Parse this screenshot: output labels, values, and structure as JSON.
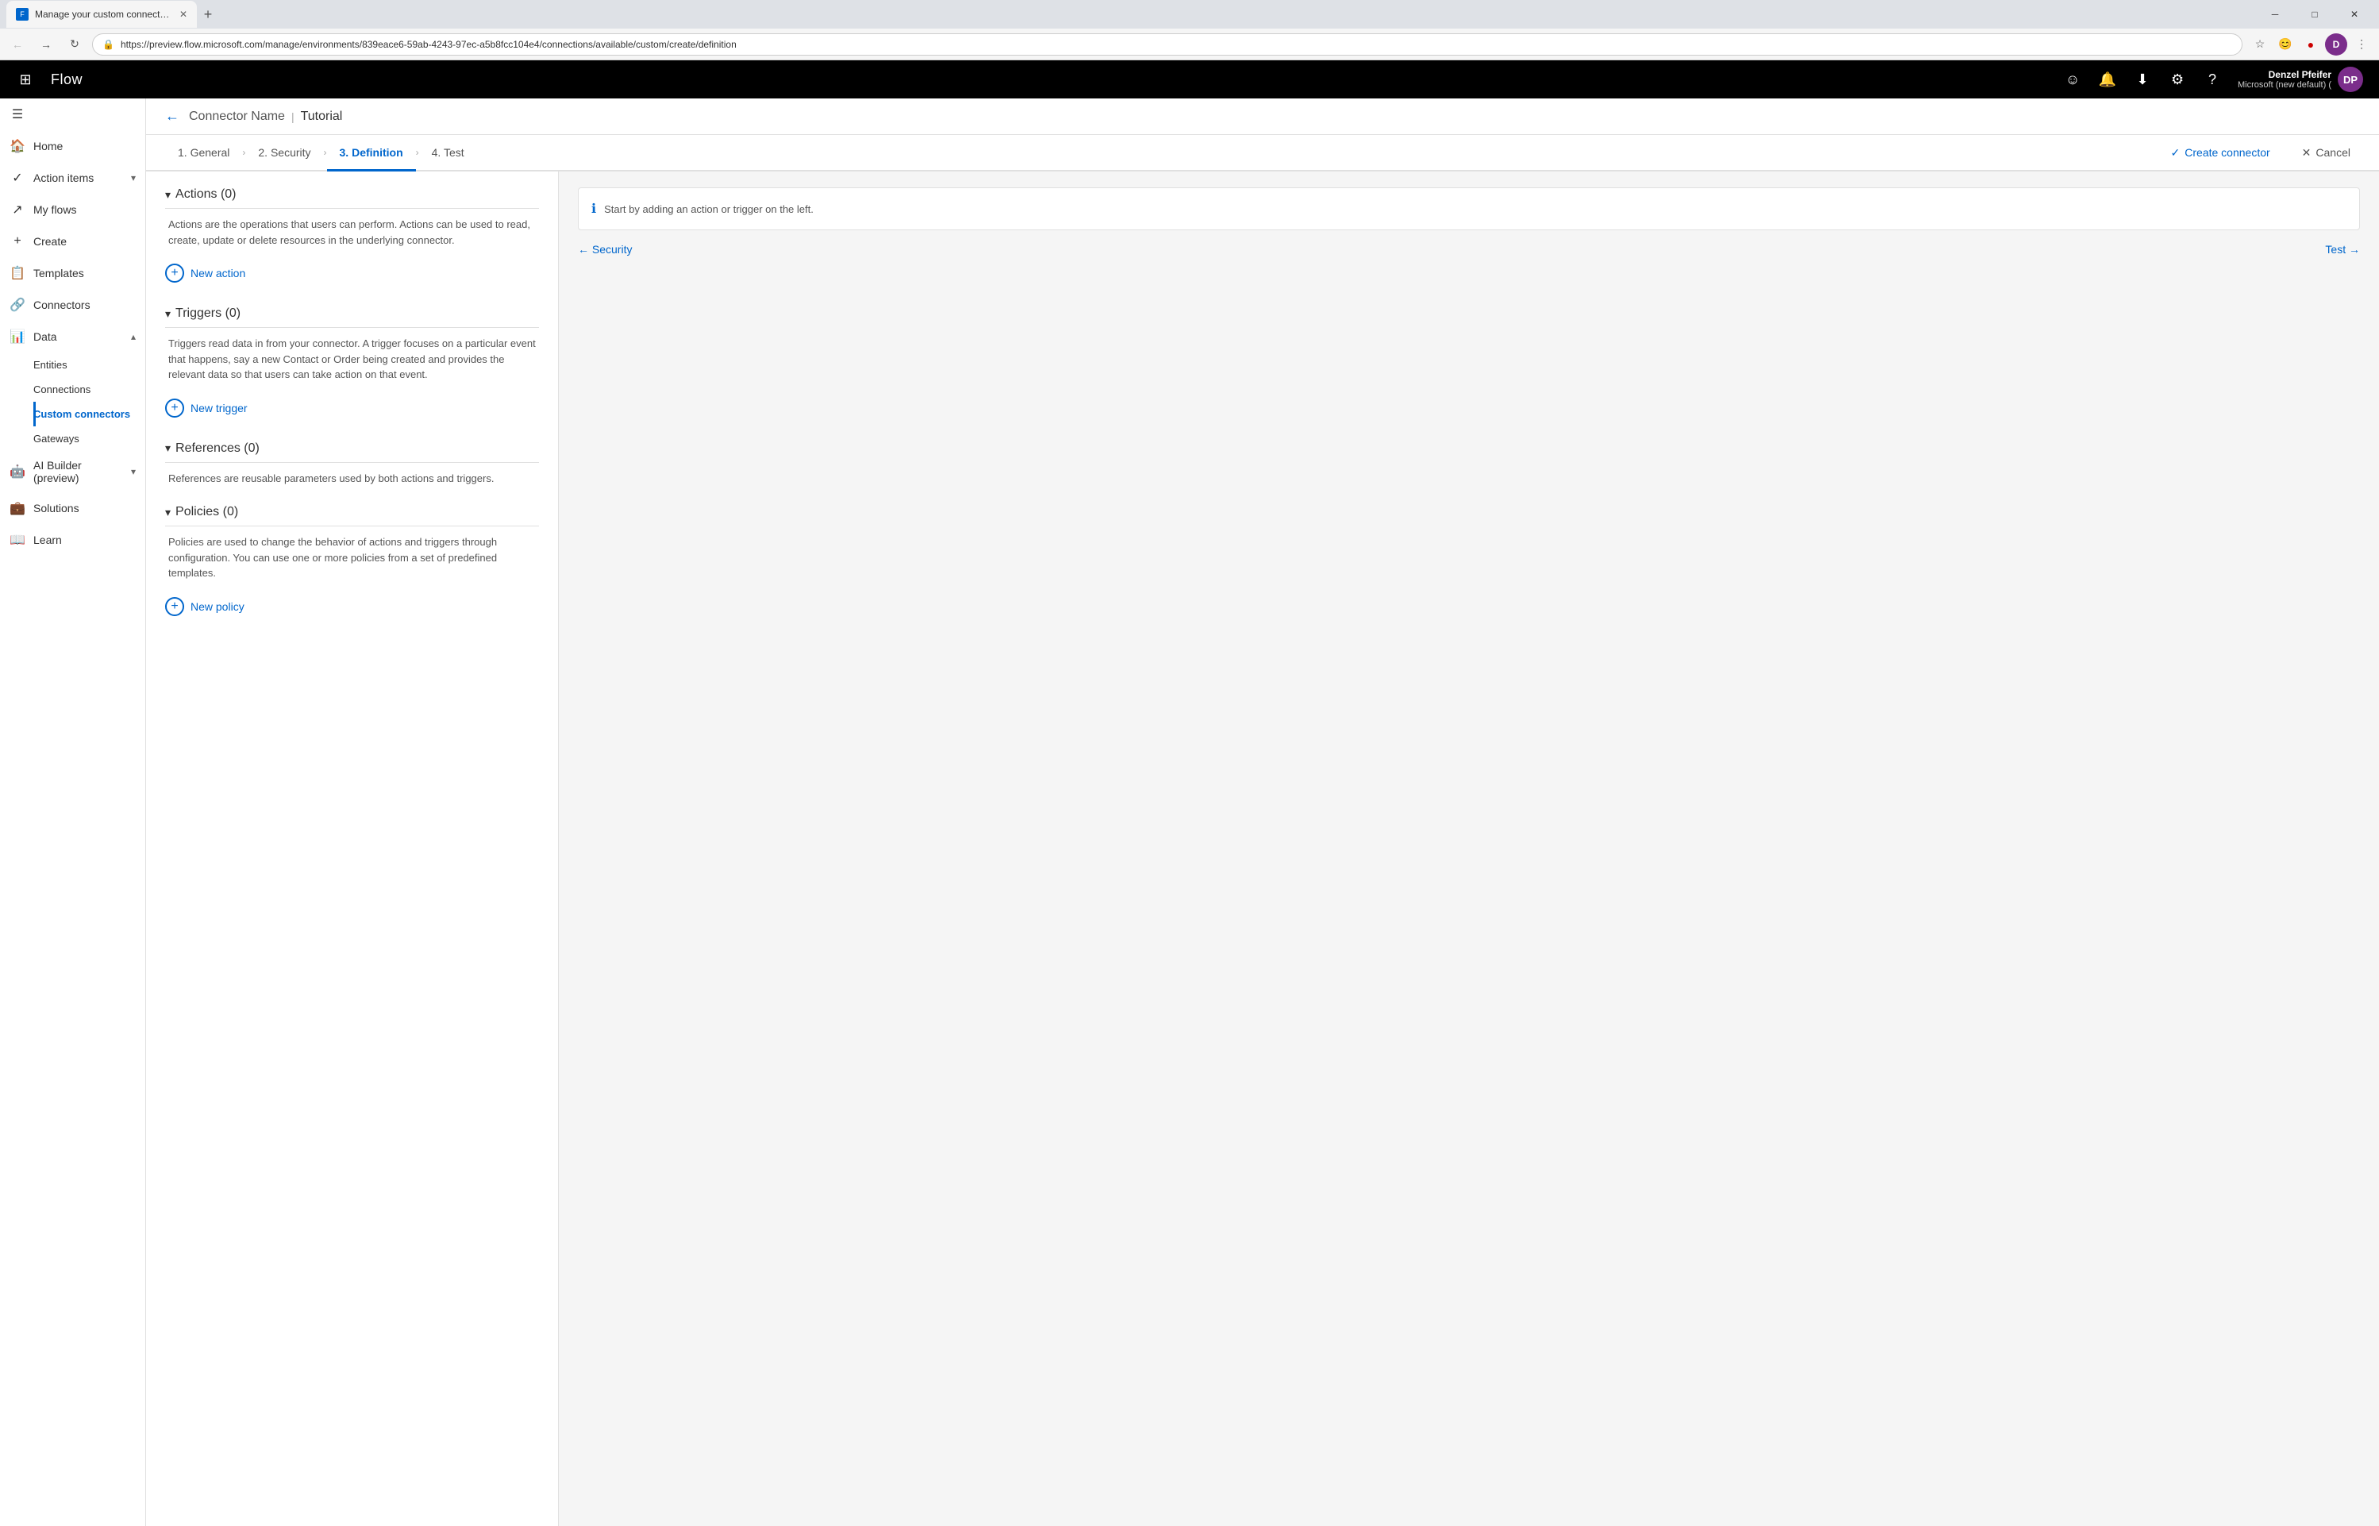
{
  "browser": {
    "tab_title": "Manage your custom connectors",
    "url": "https://preview.flow.microsoft.com/manage/environments/839eace6-59ab-4243-97ec-a5b8fcc104e4/connections/available/custom/create/definition",
    "new_tab_label": "+",
    "window_controls": {
      "minimize": "─",
      "maximize": "□",
      "close": "✕"
    }
  },
  "app_bar": {
    "brand": "Flow",
    "user_name": "Denzel Pfeifer",
    "user_org": "Microsoft (new default) (",
    "user_initials": "DP",
    "actions": {
      "emoji": "☺",
      "bell": "🔔",
      "download": "⬇",
      "settings": "⚙",
      "help": "?"
    }
  },
  "sidebar": {
    "collapse_icon": "☰",
    "items": [
      {
        "id": "home",
        "label": "Home",
        "icon": "🏠",
        "active": false
      },
      {
        "id": "action-items",
        "label": "Action items",
        "icon": "✓",
        "active": false,
        "hasChevron": true
      },
      {
        "id": "my-flows",
        "label": "My flows",
        "icon": "↗",
        "active": false
      },
      {
        "id": "create",
        "label": "Create",
        "icon": "+",
        "active": false
      },
      {
        "id": "templates",
        "label": "Templates",
        "icon": "📋",
        "active": false
      },
      {
        "id": "connectors",
        "label": "Connectors",
        "icon": "🔗",
        "active": false
      },
      {
        "id": "data",
        "label": "Data",
        "icon": "📊",
        "active": false,
        "hasChevron": true
      },
      {
        "id": "entities",
        "label": "Entities",
        "icon": "",
        "active": false,
        "submenu": true
      },
      {
        "id": "connections",
        "label": "Connections",
        "icon": "",
        "active": false,
        "submenu": true
      },
      {
        "id": "custom-connectors",
        "label": "Custom connectors",
        "icon": "",
        "active": true,
        "submenu": true
      },
      {
        "id": "gateways",
        "label": "Gateways",
        "icon": "",
        "active": false,
        "submenu": true
      },
      {
        "id": "ai-builder",
        "label": "AI Builder (preview)",
        "icon": "🤖",
        "active": false,
        "hasChevron": true
      },
      {
        "id": "solutions",
        "label": "Solutions",
        "icon": "💼",
        "active": false
      },
      {
        "id": "learn",
        "label": "Learn",
        "icon": "📖",
        "active": false
      }
    ]
  },
  "header": {
    "back_label": "←",
    "connector_name": "Connector Name",
    "separator": "|",
    "tutorial": "Tutorial"
  },
  "steps": [
    {
      "id": "general",
      "label": "1. General",
      "active": false
    },
    {
      "id": "security",
      "label": "2. Security",
      "active": false
    },
    {
      "id": "definition",
      "label": "3. Definition",
      "active": true
    },
    {
      "id": "test",
      "label": "4. Test",
      "active": false
    }
  ],
  "step_actions": {
    "create": "Create connector",
    "cancel": "Cancel",
    "check_icon": "✓",
    "x_icon": "✕"
  },
  "left_panel": {
    "actions_section": {
      "title": "Actions (0)",
      "description": "Actions are the operations that users can perform. Actions can be used to read, create, update or delete resources in the underlying connector.",
      "button_label": "New action"
    },
    "triggers_section": {
      "title": "Triggers (0)",
      "description": "Triggers read data in from your connector. A trigger focuses on a particular event that happens, say a new Contact or Order being created and provides the relevant data so that users can take action on that event.",
      "button_label": "New trigger"
    },
    "references_section": {
      "title": "References (0)",
      "description": "References are reusable parameters used by both actions and triggers.",
      "button_label": null
    },
    "policies_section": {
      "title": "Policies (0)",
      "description": "Policies are used to change the behavior of actions and triggers through configuration. You can use one or more policies from a set of predefined templates.",
      "button_label": "New policy"
    }
  },
  "right_panel": {
    "info_message": "Start by adding an action or trigger on the left.",
    "nav_back": "← Security",
    "nav_forward": "Test →"
  }
}
